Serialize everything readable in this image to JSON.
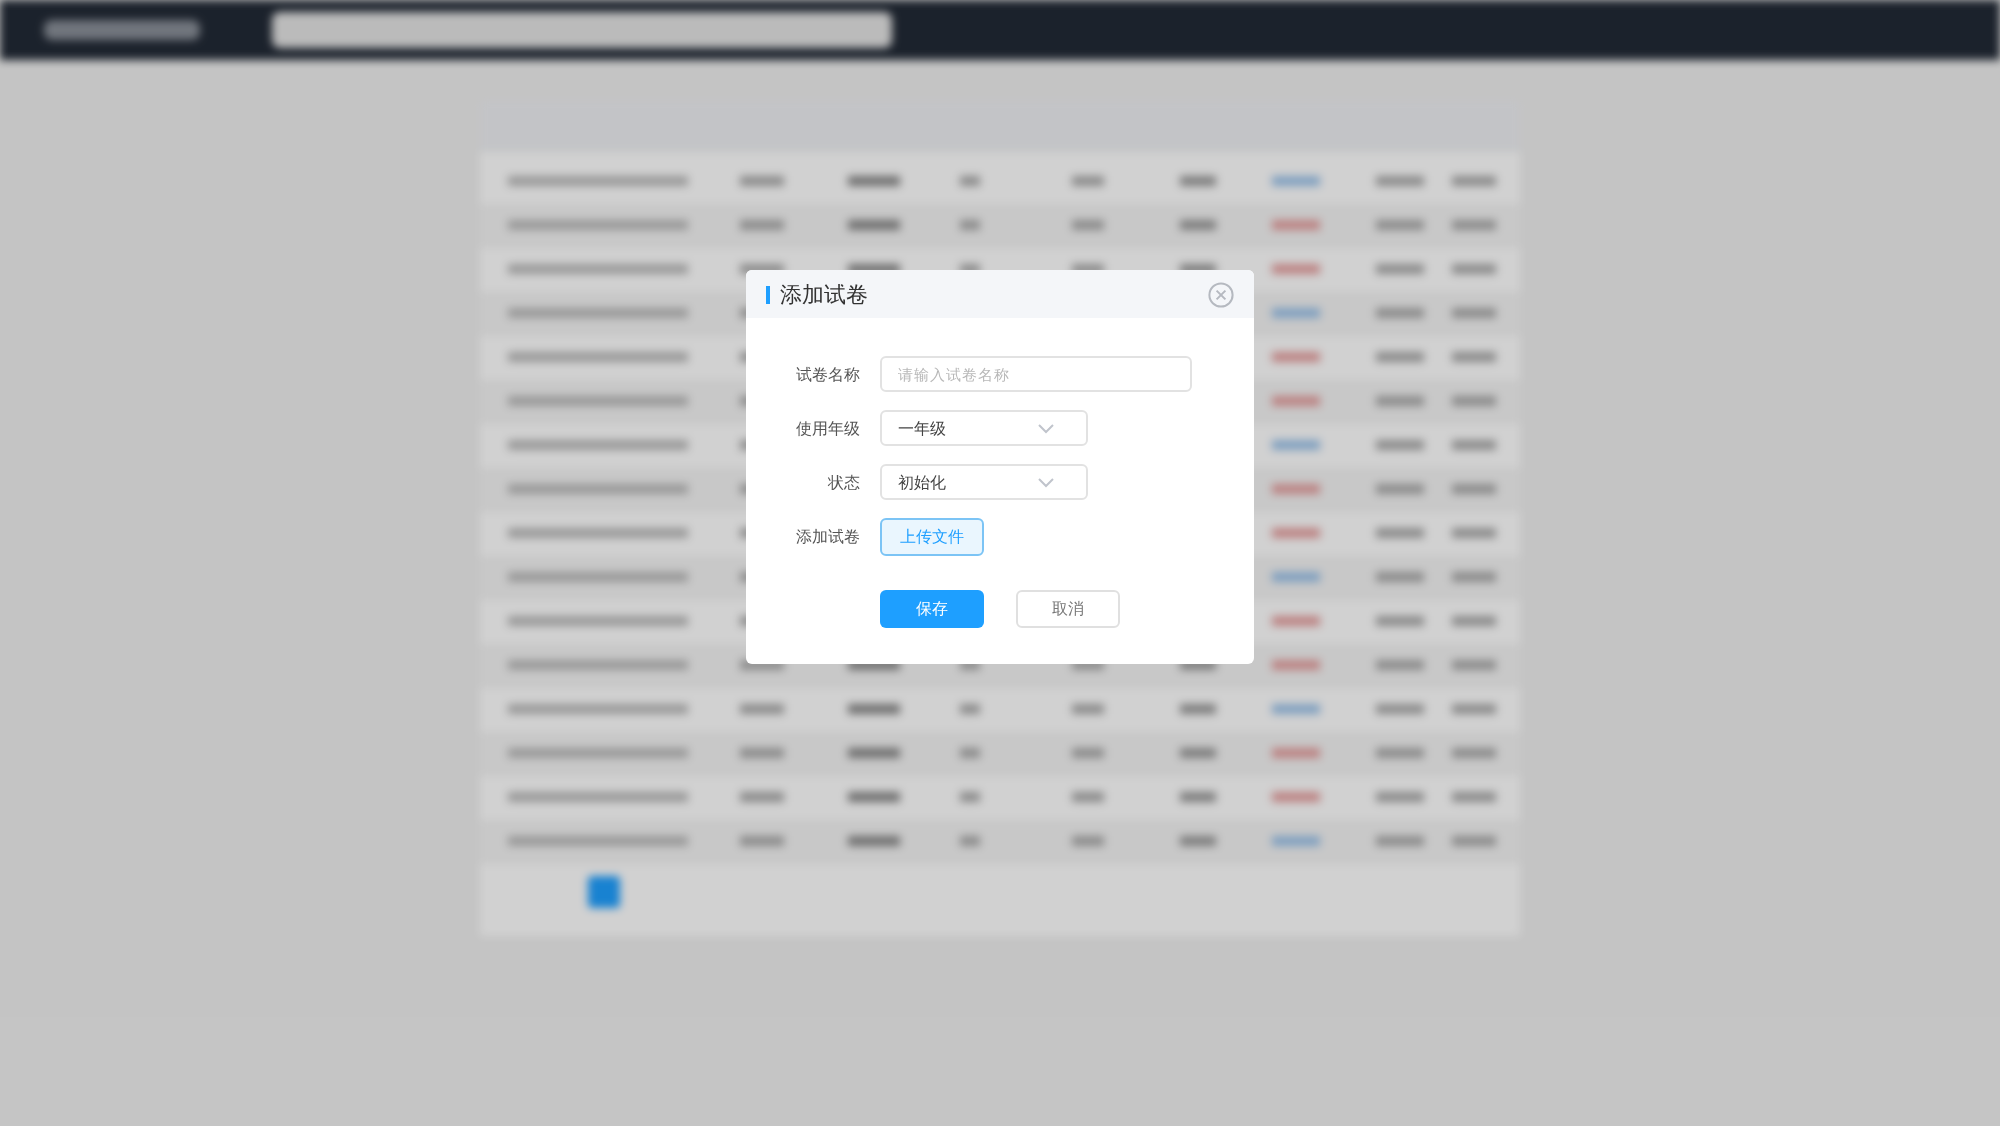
{
  "dialog": {
    "title": "添加试卷",
    "fields": [
      {
        "label": "试卷名称",
        "kind": "text",
        "placeholder": "请输入试卷名称"
      },
      {
        "label": "使用年级",
        "kind": "select",
        "value": "一年级"
      },
      {
        "label": "状态",
        "kind": "select",
        "value": "初始化"
      },
      {
        "label": "添加试卷",
        "kind": "upload",
        "button": "上传文件"
      }
    ],
    "buttons": [
      {
        "label": "保存",
        "kind": "primary"
      },
      {
        "label": "取消",
        "kind": "default"
      }
    ]
  }
}
